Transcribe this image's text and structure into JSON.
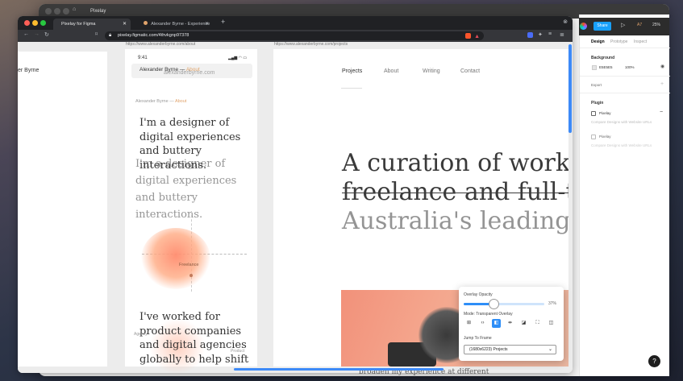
{
  "outer_window": {
    "tab_title": "Pixelay"
  },
  "figma": {
    "share_label": "Share",
    "zoom": "25%",
    "tabs": [
      "Design",
      "Prototype",
      "Inspect"
    ],
    "background_label": "Background",
    "background_color": "E5E5E5",
    "background_opacity": "100%",
    "export_label": "Export",
    "plugin_label": "Plugin",
    "plugins": [
      {
        "name": "Pixelay",
        "desc": "Compare Designs with Website URLs"
      },
      {
        "name": "Pixelay",
        "desc": "Compare Designs with Website URLs"
      }
    ],
    "help": "?"
  },
  "browser": {
    "tabs": [
      {
        "title": "Pixelay for Figma"
      },
      {
        "title": "Alexander Byrne - Experience and ..."
      }
    ],
    "url": "pixelay.figmatic.com/4thvkgnp97378"
  },
  "left_board": {
    "title": "er Byrne"
  },
  "mobile": {
    "frame_url": "https://www.alexanderbyrne.com/about",
    "time": "9:41",
    "nav_name": "Alexander Byrne",
    "nav_section": "About",
    "nav_ghost": "alexanderbyrne.com",
    "crumb_name": "Alexander Byrne",
    "crumb_section": "About",
    "intro_lines": [
      "I'm a designer of",
      "digital experiences",
      "and buttery",
      "interactions."
    ],
    "intro_ghost_lines": [
      "I'm a designer of",
      "digital experiences",
      "and buttery",
      "interactions."
    ],
    "diagram_label": "Freelance",
    "para_lines": [
      "I've worked for",
      "product companies",
      "and digital agencies",
      "globally to help shift"
    ],
    "label_agency": "Agency",
    "label_product": "Product"
  },
  "desktop": {
    "frame_url": "https://www.alexanderbyrne.com/projects",
    "nav": [
      "Projects",
      "About",
      "Writing",
      "Contact"
    ],
    "hero_lines": [
      "A curation of works s",
      "freelance and full-tim",
      "Australia's leading o"
    ],
    "bottom_text": "broaden my experience at different"
  },
  "pixelay": {
    "opacity_label": "Overlay Opacity",
    "opacity_value": "37%",
    "opacity": 0.37,
    "mode_label": "Mode: Transparent Overlay",
    "jump_label": "Jump To Frame",
    "jump_value": "(1680x6223) Projects"
  }
}
